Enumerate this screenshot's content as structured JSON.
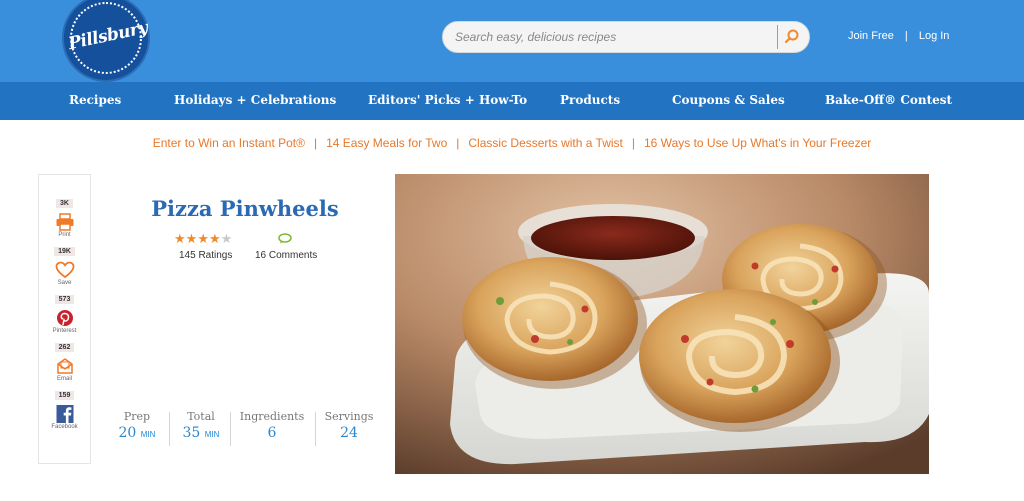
{
  "brand": {
    "name": "Pillsbury"
  },
  "search": {
    "placeholder": "Search easy, delicious recipes"
  },
  "auth": {
    "join": "Join Free",
    "separator": "|",
    "login": "Log In"
  },
  "nav": {
    "items": [
      "Recipes",
      "Holidays + Celebrations",
      "Editors' Picks + How-To",
      "Products",
      "Coupons & Sales",
      "Bake-Off® Contest"
    ]
  },
  "promo": {
    "links": [
      "Enter to Win an Instant Pot®",
      "14 Easy Meals for Two",
      "Classic Desserts with a Twist",
      "16 Ways to Use Up What's in Your Freezer"
    ],
    "separator": "|"
  },
  "share": {
    "items": [
      {
        "count": "3K",
        "label": "Print",
        "icon": "print-icon"
      },
      {
        "count": "19K",
        "label": "Save",
        "icon": "heart-icon"
      },
      {
        "count": "573",
        "label": "Pinterest",
        "icon": "pinterest-icon"
      },
      {
        "count": "262",
        "label": "Email",
        "icon": "email-icon"
      },
      {
        "count": "159",
        "label": "Facebook",
        "icon": "facebook-icon"
      }
    ]
  },
  "recipe": {
    "title": "Pizza Pinwheels",
    "rating_stars": 4,
    "rating_max": 5,
    "ratings_count": "145 Ratings",
    "comments_count": "16 Comments",
    "stats": {
      "prep": {
        "label": "Prep",
        "value": "20",
        "unit": "MIN"
      },
      "total": {
        "label": "Total",
        "value": "35",
        "unit": "MIN"
      },
      "ingredients": {
        "label": "Ingredients",
        "value": "6"
      },
      "servings": {
        "label": "Servings",
        "value": "24"
      }
    }
  },
  "colors": {
    "header_blue": "#3a8fdc",
    "nav_blue": "#2373c3",
    "accent_orange": "#e8782a",
    "title_blue": "#2a6ab4"
  }
}
